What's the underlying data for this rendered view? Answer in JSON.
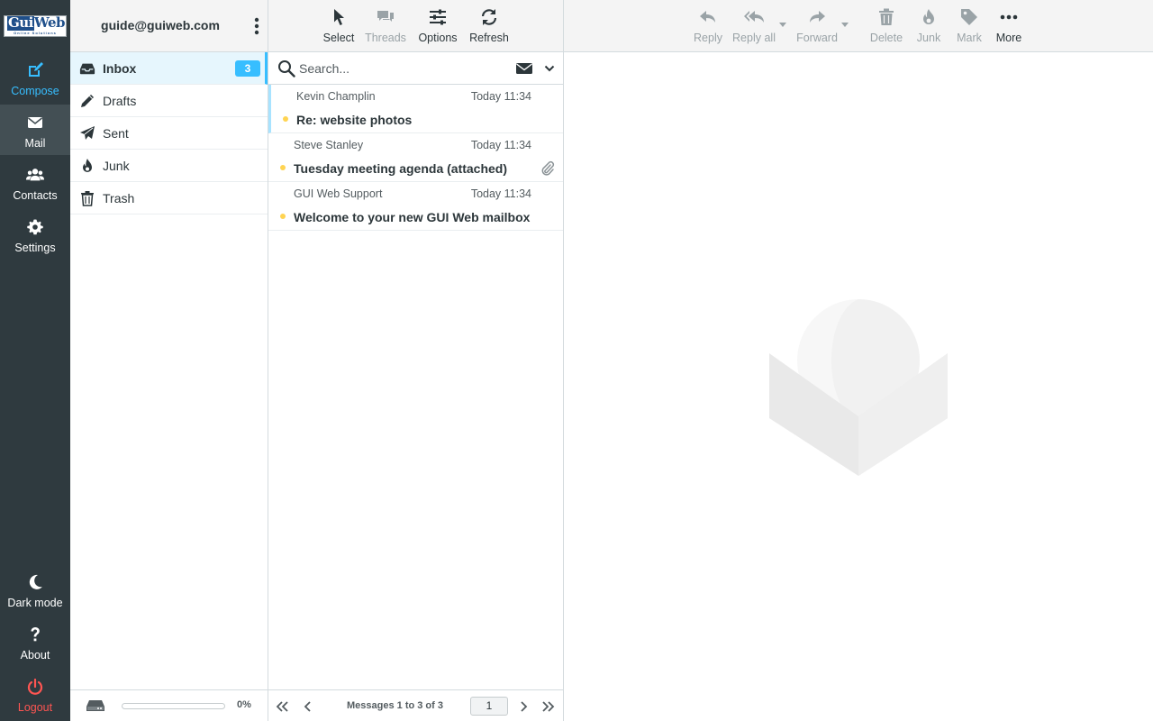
{
  "app": {
    "logo_text_a": "Gui",
    "logo_text_b": "Web",
    "logo_tagline": "Online Solutions",
    "accent_color": "#37beff"
  },
  "taskmenu": {
    "items": [
      {
        "label": "Compose",
        "icon": "compose-icon"
      },
      {
        "label": "Mail",
        "icon": "envelope-icon"
      },
      {
        "label": "Contacts",
        "icon": "users-icon"
      },
      {
        "label": "Settings",
        "icon": "gear-icon"
      }
    ],
    "bottom": [
      {
        "label": "Dark mode",
        "icon": "moon-icon"
      },
      {
        "label": "About",
        "icon": "question-icon"
      },
      {
        "label": "Logout",
        "icon": "power-icon"
      }
    ]
  },
  "account": {
    "email": "guide@guiweb.com"
  },
  "folders": [
    {
      "label": "Inbox",
      "icon": "inbox-icon",
      "unread": "3"
    },
    {
      "label": "Drafts",
      "icon": "pencil-icon"
    },
    {
      "label": "Sent",
      "icon": "paper-plane-icon"
    },
    {
      "label": "Junk",
      "icon": "fire-icon"
    },
    {
      "label": "Trash",
      "icon": "trash-icon"
    }
  ],
  "quota": {
    "percent_text": "0%",
    "used_fraction": 0
  },
  "list_toolbar": {
    "select": "Select",
    "threads": "Threads",
    "options": "Options",
    "refresh": "Refresh"
  },
  "search": {
    "placeholder": "Search..."
  },
  "messages": [
    {
      "from": "Kevin Champlin",
      "date": "Today 11:34",
      "subject": "Re: website photos",
      "unread": true,
      "attachment": false
    },
    {
      "from": "Steve Stanley",
      "date": "Today 11:34",
      "subject": "Tuesday meeting agenda (attached)",
      "unread": true,
      "attachment": true
    },
    {
      "from": "GUI Web Support",
      "date": "Today 11:34",
      "subject": "Welcome to your new GUI Web mailbox",
      "unread": true,
      "attachment": false
    }
  ],
  "pager": {
    "count_text": "Messages 1 to 3 of 3",
    "page": "1"
  },
  "message_toolbar": {
    "reply": "Reply",
    "reply_all": "Reply all",
    "forward": "Forward",
    "delete": "Delete",
    "junk": "Junk",
    "mark": "Mark",
    "more": "More"
  }
}
